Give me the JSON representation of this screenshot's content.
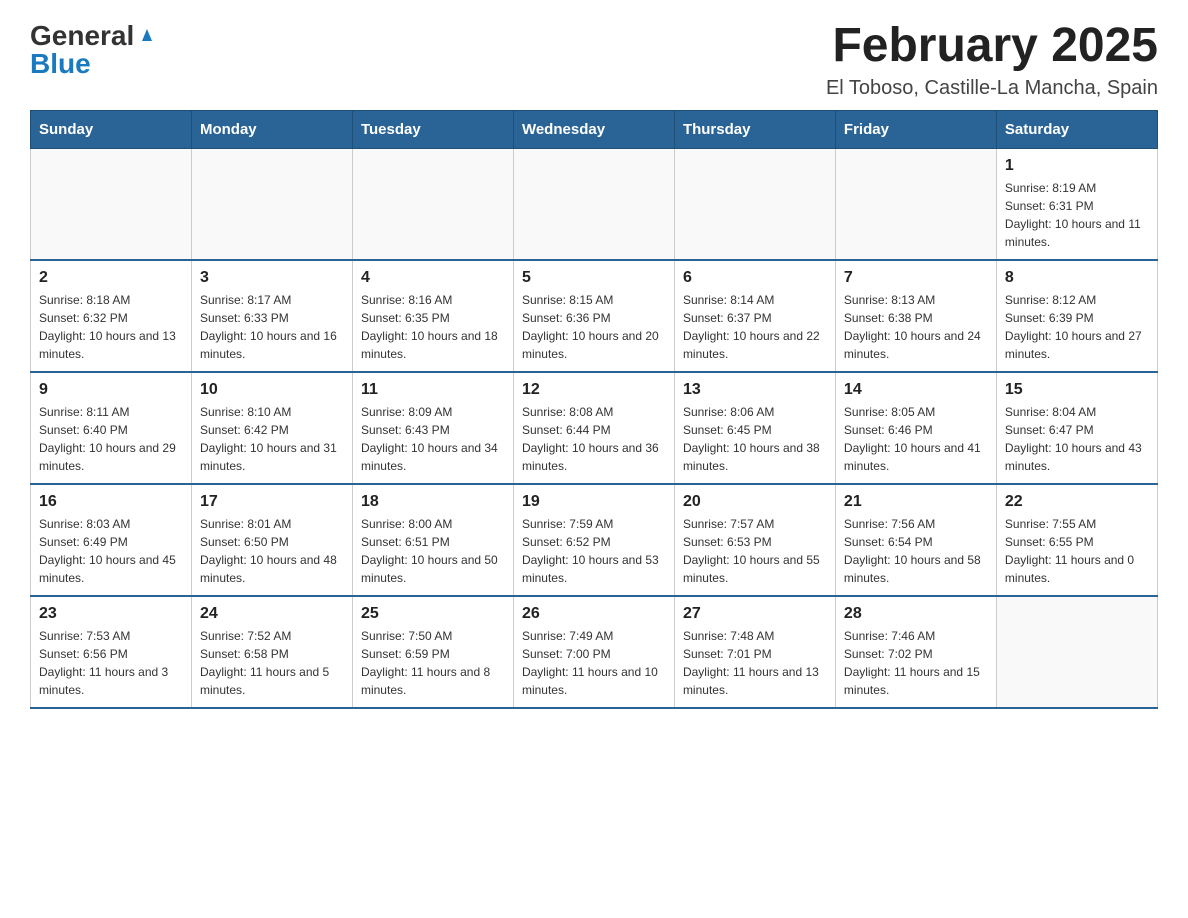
{
  "header": {
    "logo": {
      "general": "General",
      "blue": "Blue",
      "triangle_title": "GeneralBlue logo"
    },
    "title": "February 2025",
    "subtitle": "El Toboso, Castille-La Mancha, Spain"
  },
  "weekdays": [
    "Sunday",
    "Monday",
    "Tuesday",
    "Wednesday",
    "Thursday",
    "Friday",
    "Saturday"
  ],
  "weeks": [
    {
      "days": [
        {
          "num": "",
          "info": ""
        },
        {
          "num": "",
          "info": ""
        },
        {
          "num": "",
          "info": ""
        },
        {
          "num": "",
          "info": ""
        },
        {
          "num": "",
          "info": ""
        },
        {
          "num": "",
          "info": ""
        },
        {
          "num": "1",
          "info": "Sunrise: 8:19 AM\nSunset: 6:31 PM\nDaylight: 10 hours and 11 minutes."
        }
      ]
    },
    {
      "days": [
        {
          "num": "2",
          "info": "Sunrise: 8:18 AM\nSunset: 6:32 PM\nDaylight: 10 hours and 13 minutes."
        },
        {
          "num": "3",
          "info": "Sunrise: 8:17 AM\nSunset: 6:33 PM\nDaylight: 10 hours and 16 minutes."
        },
        {
          "num": "4",
          "info": "Sunrise: 8:16 AM\nSunset: 6:35 PM\nDaylight: 10 hours and 18 minutes."
        },
        {
          "num": "5",
          "info": "Sunrise: 8:15 AM\nSunset: 6:36 PM\nDaylight: 10 hours and 20 minutes."
        },
        {
          "num": "6",
          "info": "Sunrise: 8:14 AM\nSunset: 6:37 PM\nDaylight: 10 hours and 22 minutes."
        },
        {
          "num": "7",
          "info": "Sunrise: 8:13 AM\nSunset: 6:38 PM\nDaylight: 10 hours and 24 minutes."
        },
        {
          "num": "8",
          "info": "Sunrise: 8:12 AM\nSunset: 6:39 PM\nDaylight: 10 hours and 27 minutes."
        }
      ]
    },
    {
      "days": [
        {
          "num": "9",
          "info": "Sunrise: 8:11 AM\nSunset: 6:40 PM\nDaylight: 10 hours and 29 minutes."
        },
        {
          "num": "10",
          "info": "Sunrise: 8:10 AM\nSunset: 6:42 PM\nDaylight: 10 hours and 31 minutes."
        },
        {
          "num": "11",
          "info": "Sunrise: 8:09 AM\nSunset: 6:43 PM\nDaylight: 10 hours and 34 minutes."
        },
        {
          "num": "12",
          "info": "Sunrise: 8:08 AM\nSunset: 6:44 PM\nDaylight: 10 hours and 36 minutes."
        },
        {
          "num": "13",
          "info": "Sunrise: 8:06 AM\nSunset: 6:45 PM\nDaylight: 10 hours and 38 minutes."
        },
        {
          "num": "14",
          "info": "Sunrise: 8:05 AM\nSunset: 6:46 PM\nDaylight: 10 hours and 41 minutes."
        },
        {
          "num": "15",
          "info": "Sunrise: 8:04 AM\nSunset: 6:47 PM\nDaylight: 10 hours and 43 minutes."
        }
      ]
    },
    {
      "days": [
        {
          "num": "16",
          "info": "Sunrise: 8:03 AM\nSunset: 6:49 PM\nDaylight: 10 hours and 45 minutes."
        },
        {
          "num": "17",
          "info": "Sunrise: 8:01 AM\nSunset: 6:50 PM\nDaylight: 10 hours and 48 minutes."
        },
        {
          "num": "18",
          "info": "Sunrise: 8:00 AM\nSunset: 6:51 PM\nDaylight: 10 hours and 50 minutes."
        },
        {
          "num": "19",
          "info": "Sunrise: 7:59 AM\nSunset: 6:52 PM\nDaylight: 10 hours and 53 minutes."
        },
        {
          "num": "20",
          "info": "Sunrise: 7:57 AM\nSunset: 6:53 PM\nDaylight: 10 hours and 55 minutes."
        },
        {
          "num": "21",
          "info": "Sunrise: 7:56 AM\nSunset: 6:54 PM\nDaylight: 10 hours and 58 minutes."
        },
        {
          "num": "22",
          "info": "Sunrise: 7:55 AM\nSunset: 6:55 PM\nDaylight: 11 hours and 0 minutes."
        }
      ]
    },
    {
      "days": [
        {
          "num": "23",
          "info": "Sunrise: 7:53 AM\nSunset: 6:56 PM\nDaylight: 11 hours and 3 minutes."
        },
        {
          "num": "24",
          "info": "Sunrise: 7:52 AM\nSunset: 6:58 PM\nDaylight: 11 hours and 5 minutes."
        },
        {
          "num": "25",
          "info": "Sunrise: 7:50 AM\nSunset: 6:59 PM\nDaylight: 11 hours and 8 minutes."
        },
        {
          "num": "26",
          "info": "Sunrise: 7:49 AM\nSunset: 7:00 PM\nDaylight: 11 hours and 10 minutes."
        },
        {
          "num": "27",
          "info": "Sunrise: 7:48 AM\nSunset: 7:01 PM\nDaylight: 11 hours and 13 minutes."
        },
        {
          "num": "28",
          "info": "Sunrise: 7:46 AM\nSunset: 7:02 PM\nDaylight: 11 hours and 15 minutes."
        },
        {
          "num": "",
          "info": ""
        }
      ]
    }
  ]
}
